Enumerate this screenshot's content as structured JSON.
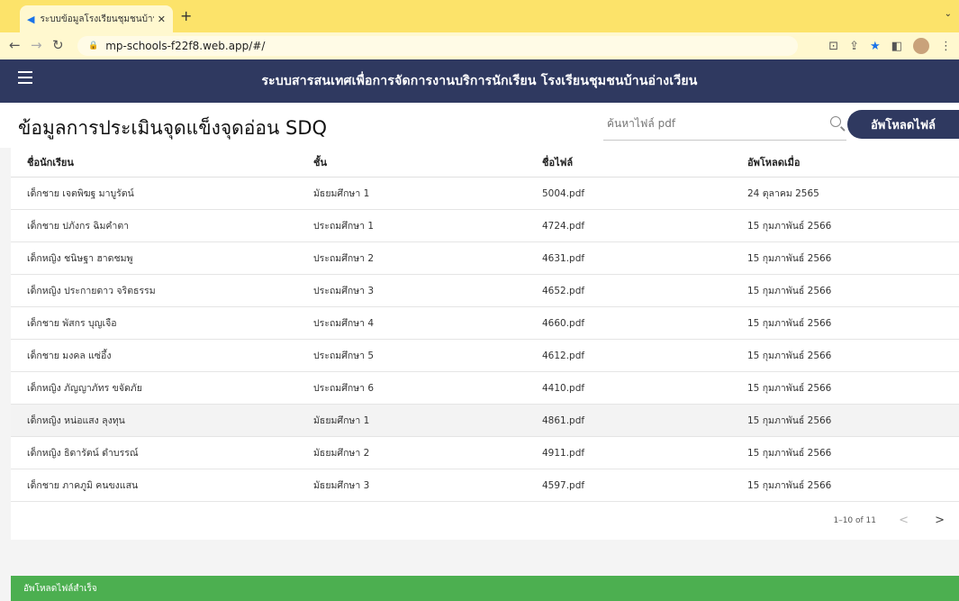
{
  "browser": {
    "tab_title": "ระบบข้อมูลโรงเรียนชุมชนบ้านอ่างเ...",
    "new_tab": "+",
    "url": "mp-schools-f22f8.web.app/#/"
  },
  "appbar": {
    "title": "ระบบสารสนเทศเพื่อการจัดการงานบริการนักเรียน โรงเรียนชุมชนบ้านอ่างเวียน"
  },
  "page": {
    "title": "ข้อมูลการประเมินจุดแข็งจุดอ่อน SDQ",
    "search_placeholder": "ค้นหาไฟล์ pdf",
    "upload_button": "อัพโหลดไฟล์"
  },
  "table": {
    "headers": [
      "ชื่อนักเรียน",
      "ชั้น",
      "ชื่อไฟล์",
      "อัพโหลดเมื่อ"
    ],
    "rows": [
      [
        "เด็กชาย เจตพิฆฐ มาบูรัตน์",
        "มัธยมศึกษา 1",
        "5004.pdf",
        "24 ตุลาคม 2565"
      ],
      [
        "เด็กชาย ปภังกร ฉิมคำตา",
        "ประถมศึกษา 1",
        "4724.pdf",
        "15 กุมภาพันธ์ 2566"
      ],
      [
        "เด็กหญิง ชนิษฐา ฮาดชมพู",
        "ประถมศึกษา 2",
        "4631.pdf",
        "15 กุมภาพันธ์ 2566"
      ],
      [
        "เด็กหญิง ประกายดาว จริตธรรม",
        "ประถมศึกษา 3",
        "4652.pdf",
        "15 กุมภาพันธ์ 2566"
      ],
      [
        "เด็กชาย พัสกร บุญเจือ",
        "ประถมศึกษา 4",
        "4660.pdf",
        "15 กุมภาพันธ์ 2566"
      ],
      [
        "เด็กชาย มงคล แซ่อึ้ง",
        "ประถมศึกษา 5",
        "4612.pdf",
        "15 กุมภาพันธ์ 2566"
      ],
      [
        "เด็กหญิง ภัญญาภัทร ขจัดภัย",
        "ประถมศึกษา 6",
        "4410.pdf",
        "15 กุมภาพันธ์ 2566"
      ],
      [
        "เด็กหญิง หน่อแสง ลุงทุน",
        "มัธยมศึกษา 1",
        "4861.pdf",
        "15 กุมภาพันธ์ 2566"
      ],
      [
        "เด็กหญิง ธิดารัตน์ ดำบรรณ์",
        "มัธยมศึกษา 2",
        "4911.pdf",
        "15 กุมภาพันธ์ 2566"
      ],
      [
        "เด็กชาย ภาคภูมิ คนขงแสน",
        "มัธยมศึกษา 3",
        "4597.pdf",
        "15 กุมภาพันธ์ 2566"
      ]
    ]
  },
  "pagination": {
    "range": "1–10 of 11"
  },
  "snackbar": {
    "message": "อัพโหลดไฟล์สำเร็จ"
  },
  "colors": {
    "appbar": "#2f3960",
    "tabbar": "#fce36a",
    "snackbar": "#4caf50"
  },
  "icons": [
    "menu-icon",
    "search-icon",
    "chevron-left-icon",
    "chevron-right-icon"
  ]
}
